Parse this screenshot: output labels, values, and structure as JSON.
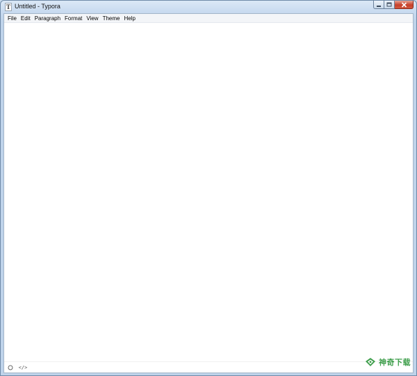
{
  "window": {
    "title": "Untitled - Typora",
    "app_icon": "T",
    "caption_buttons": [
      "minimize-icon",
      "maximize-icon",
      "close-icon"
    ]
  },
  "menubar": {
    "items": [
      {
        "label": "File"
      },
      {
        "label": "Edit"
      },
      {
        "label": "Paragraph"
      },
      {
        "label": "Format"
      },
      {
        "label": "View"
      },
      {
        "label": "Theme"
      },
      {
        "label": "Help"
      }
    ]
  },
  "statusbar": {
    "sidebar_toggle_icon": "circle-icon",
    "source_toggle_label": "</>"
  },
  "watermark": {
    "text": "神奇下载",
    "color": "#3e9e4b"
  },
  "colors": {
    "accent": "#3e9e4b",
    "titlebar": "#c6d9ef",
    "close_button": "#c6402b",
    "menubar": "#f3f5f8"
  }
}
